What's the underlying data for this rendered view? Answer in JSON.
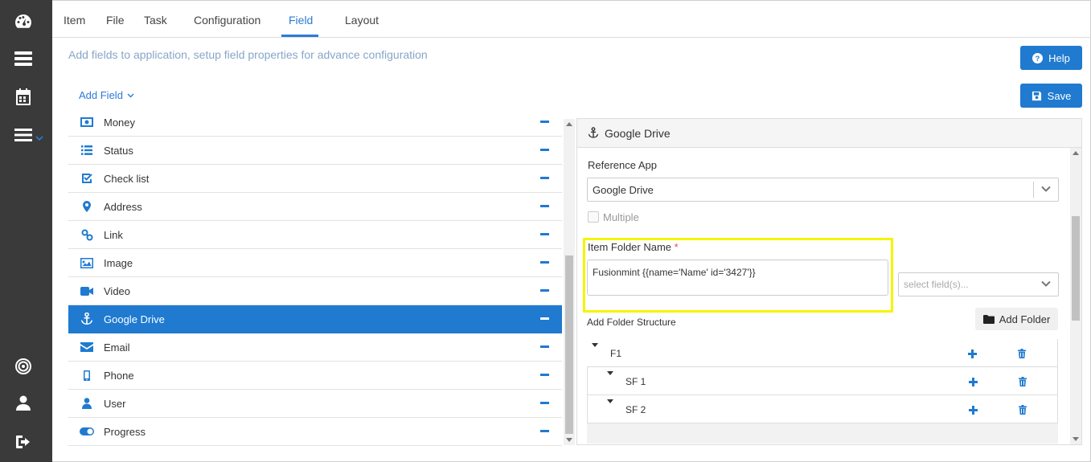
{
  "rail": {
    "icons": [
      "dashboard-icon",
      "server-icon",
      "calendar-icon",
      "menu-icon",
      "target-icon",
      "user-icon",
      "sign-out-icon"
    ]
  },
  "tabs": [
    "Item",
    "File",
    "Task",
    "Configuration",
    "Field",
    "Layout"
  ],
  "active_tab": "Field",
  "subtitle": "Add fields to application, setup field properties for advance configuration",
  "buttons": {
    "help": "Help",
    "save": "Save",
    "add_field": "Add Field",
    "add_folder": "Add Folder"
  },
  "fields": [
    {
      "label": "Money",
      "icon": "money-icon"
    },
    {
      "label": "Status",
      "icon": "list-icon"
    },
    {
      "label": "Check list",
      "icon": "check-square-icon"
    },
    {
      "label": "Address",
      "icon": "map-marker-icon"
    },
    {
      "label": "Link",
      "icon": "link-icon"
    },
    {
      "label": "Image",
      "icon": "image-icon"
    },
    {
      "label": "Video",
      "icon": "video-camera-icon"
    },
    {
      "label": "Google Drive",
      "icon": "anchor-icon",
      "selected": true
    },
    {
      "label": "Email",
      "icon": "envelope-icon"
    },
    {
      "label": "Phone",
      "icon": "mobile-icon"
    },
    {
      "label": "User",
      "icon": "user-icon"
    },
    {
      "label": "Progress",
      "icon": "toggle-on-icon"
    }
  ],
  "panel": {
    "title": "Google Drive",
    "reference_app_label": "Reference App",
    "reference_app_value": "Google Drive",
    "multiple_label": "Multiple",
    "folder_name_label": "Item Folder Name",
    "required_mark": "*",
    "folder_name_value": "Fusionmint {{name='Name' id='3427'}}",
    "select_fields_placeholder": "select field(s)...",
    "folder_structure_label": "Add Folder Structure",
    "tree": [
      {
        "label": "F1",
        "level": 0
      },
      {
        "label": "SF 1",
        "level": 1
      },
      {
        "label": "SF 2",
        "level": 1
      }
    ]
  },
  "colors": {
    "accent": "#1f7ad0",
    "rail": "#3a3a3a",
    "highlight": "#f5f500"
  }
}
